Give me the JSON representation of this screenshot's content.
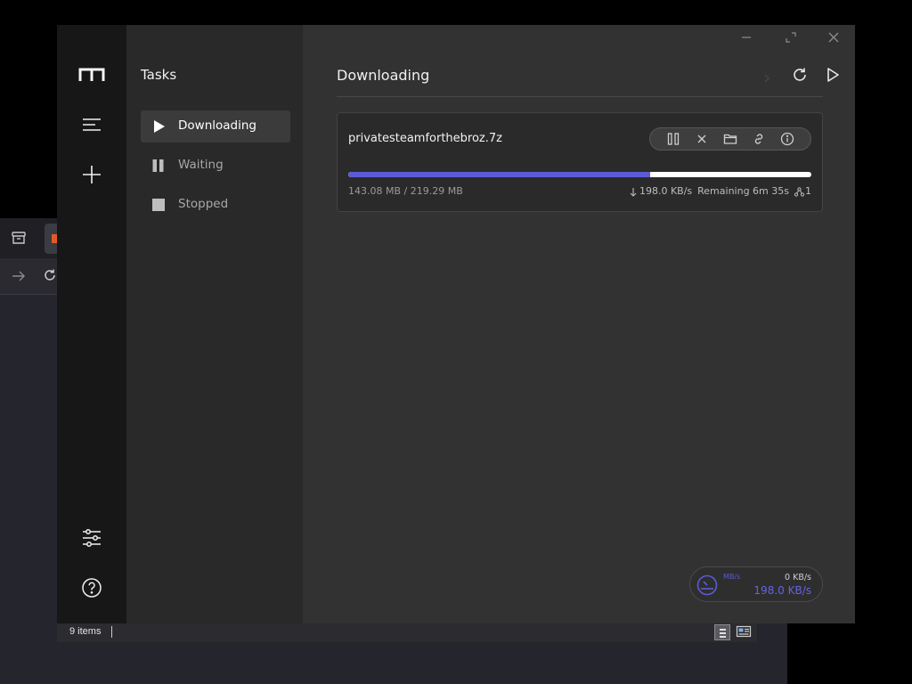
{
  "explorer": {
    "items_count": "9 items"
  },
  "app": {
    "sidebar_title": "Tasks",
    "task_filters": [
      {
        "label": "Downloading",
        "active": true
      },
      {
        "label": "Waiting",
        "active": false
      },
      {
        "label": "Stopped",
        "active": false
      }
    ],
    "main_title": "Downloading",
    "tasks": [
      {
        "name": "privatesteamforthebroz.7z",
        "progress": 0.652,
        "size": "143.08 MB / 219.29 MB",
        "speed": "198.0 KB/s",
        "remaining": "Remaining 6m 35s",
        "connections": "1"
      }
    ],
    "speedometer": {
      "unit": "MB/s",
      "upload": "0 KB/s",
      "download": "198.0 KB/s"
    },
    "colors": {
      "accent": "#5b5bd6",
      "nav_bg": "#171717",
      "subnav_bg": "#292929",
      "main_bg": "#323232"
    }
  }
}
